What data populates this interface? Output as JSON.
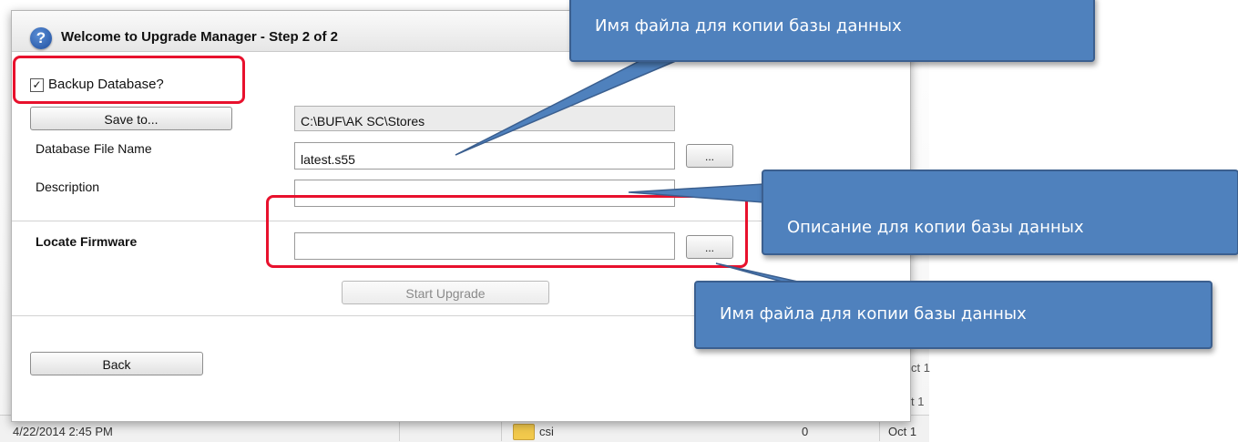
{
  "dialog": {
    "title": "Welcome to Upgrade Manager - Step 2 of 2",
    "backup_checkbox": {
      "label": "Backup Database?",
      "checked": true,
      "check_glyph": "✓"
    },
    "save_to_button": "Save to...",
    "save_path": "C:\\BUF\\AK SC\\Stores",
    "database_file_name": {
      "label": "Database File Name",
      "value": "latest.s55",
      "browse_label": "..."
    },
    "description": {
      "label": "Description",
      "value": ""
    },
    "locate_firmware": {
      "label": "Locate Firmware",
      "value": "",
      "browse_label": "..."
    },
    "start_upgrade_button": "Start Upgrade",
    "back_button": "Back"
  },
  "background": {
    "date": "4/22/2014 2:45 PM",
    "folder_name": "csi",
    "size": "0",
    "modified_short": "Oct 1",
    "right_edge_items": [
      "ct 1",
      "t 1"
    ]
  },
  "callouts": [
    {
      "text": "Имя файла для копии базы данных"
    },
    {
      "text": "Описание  для копии базы данных"
    },
    {
      "text": "Имя файла для копии базы данных"
    }
  ],
  "colors": {
    "callout_fill": "#4f81bd",
    "callout_border": "#3b5f8f",
    "highlight": "#e8112d",
    "help_icon": "#1f4e9e"
  },
  "icons": {
    "help": "question-mark-icon",
    "folder": "folder-icon"
  }
}
